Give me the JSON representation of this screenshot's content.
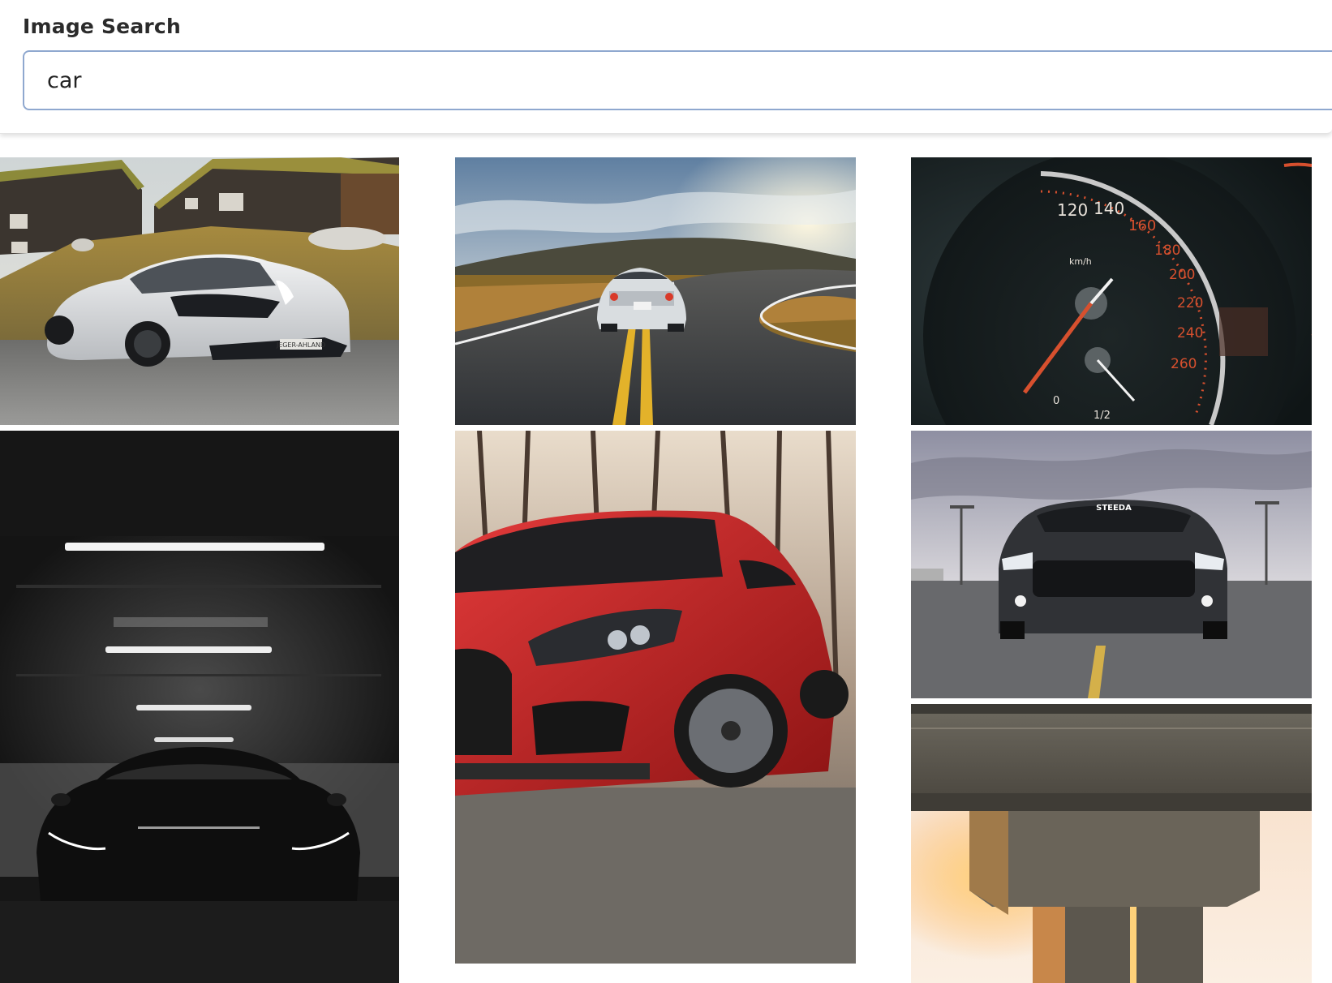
{
  "search": {
    "label": "Image Search",
    "value": "car",
    "placeholder": ""
  },
  "results": [
    {
      "subject": "white supercar on gravel in front of dark wooden houses",
      "plate_text": "JEGER-AHLAND"
    },
    {
      "subject": "silver sports car driving on a curved road at sunset"
    },
    {
      "subject": "speedometer gauge close-up",
      "gauge_labels": [
        "120",
        "140",
        "160",
        "180",
        "200",
        "220",
        "240",
        "260",
        "km/h",
        "0",
        "1/2"
      ]
    },
    {
      "subject": "black car in a dark parking garage under fluorescent lights"
    },
    {
      "subject": "red hatchback front quarter view among bare trees"
    },
    {
      "subject": "black muscle car front view in an empty parking lot",
      "windshield_text": "STEEDA"
    },
    {
      "subject": "concrete bridge pillar with setting sun behind"
    }
  ],
  "colors": {
    "input_border": "#8fa8cf",
    "label_text": "#2b2b2b"
  }
}
